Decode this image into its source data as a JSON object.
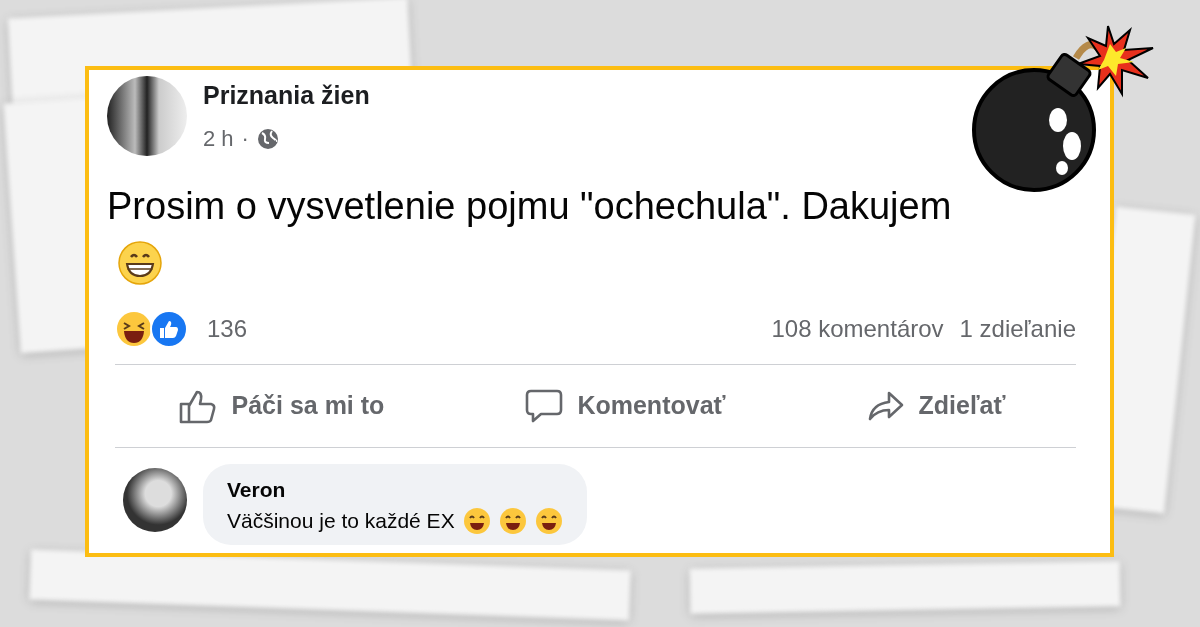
{
  "post": {
    "page_name": "Priznania žien",
    "time": "2 h",
    "separator": "·",
    "text": "Prosim o vysvetlenie pojmu \"ochechula\". Dakujem",
    "reaction_count": "136",
    "comments_count": "108 komentárov",
    "shares_count": "1 zdieľanie",
    "actions": [
      {
        "kind": "like",
        "label": "Páči sa mi to"
      },
      {
        "kind": "comment",
        "label": "Komentovať"
      },
      {
        "kind": "share",
        "label": "Zdieľať"
      }
    ],
    "comment": {
      "author": "Veron",
      "text": "Väčšinou je to každé EX"
    }
  }
}
